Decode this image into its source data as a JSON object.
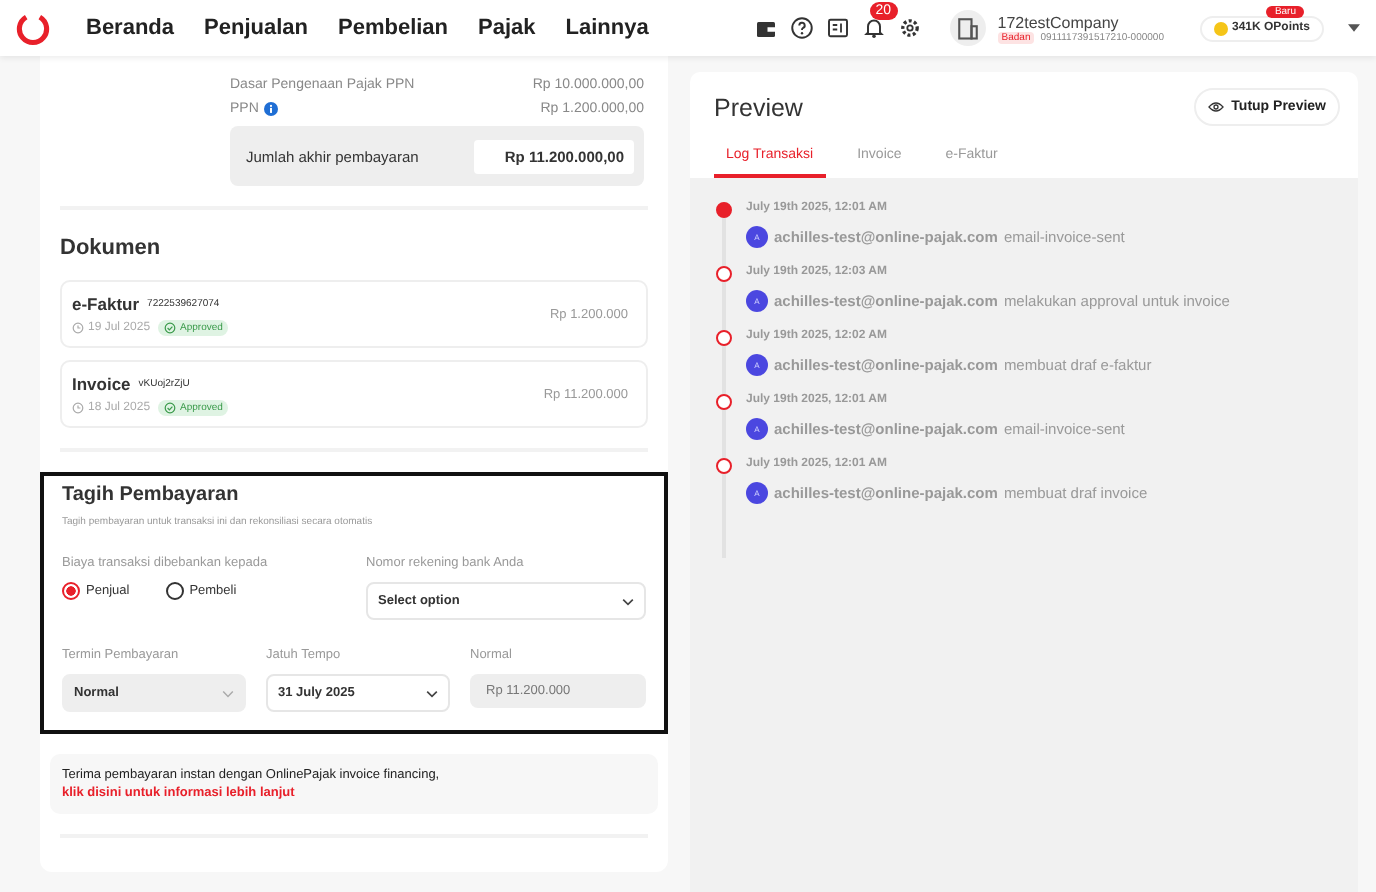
{
  "header": {
    "nav": [
      "Beranda",
      "Penjualan",
      "Pembelian",
      "Pajak",
      "Lainnya"
    ],
    "notification_count": "20",
    "company": "172testCompany",
    "company_badge": "Badan",
    "npwp": "0911117391517210-000000",
    "points": "341K OPoints",
    "points_badge": "Baru"
  },
  "summary": {
    "rows": [
      {
        "label": "Dasar Pengenaan Pajak PPN",
        "value": "Rp 10.000.000,00",
        "info": false
      },
      {
        "label": "PPN",
        "value": "Rp 1.200.000,00",
        "info": true
      }
    ],
    "total": {
      "label": "Jumlah akhir pembayaran",
      "value": "Rp 11.200.000,00"
    }
  },
  "documents": {
    "title": "Dokumen",
    "items": [
      {
        "type": "e-Faktur",
        "number": "7222539627074",
        "date": "19 Jul 2025",
        "status": "Approved",
        "amount": "Rp 1.200.000"
      },
      {
        "type": "Invoice",
        "number": "vKUoj2rZjU",
        "date": "18 Jul 2025",
        "status": "Approved",
        "amount": "Rp 11.200.000"
      }
    ]
  },
  "billing": {
    "title": "Tagih Pembayaran",
    "subtitle": "Tagih pembayaran untuk transaksi ini dan rekonsiliasi secara otomatis",
    "charge_label": "Biaya transaksi dibebankan kepada",
    "options": [
      {
        "label": "Penjual",
        "selected": true
      },
      {
        "label": "Pembeli",
        "selected": false
      }
    ],
    "bank_label": "Nomor rekening bank Anda",
    "bank_placeholder": "Select option",
    "term_label": "Termin Pembayaran",
    "term_value": "Normal",
    "due_label": "Jatuh Tempo",
    "due_value": "31 July 2025",
    "normal_label": "Normal",
    "normal_value": "Rp 11.200.000"
  },
  "financing": {
    "text": "Terima pembayaran instan dengan OnlinePajak invoice financing,",
    "link": "klik disini untuk informasi lebih lanjut"
  },
  "preview": {
    "title": "Preview",
    "close_button": "Tutup Preview",
    "tabs": [
      {
        "label": "Log Transaksi",
        "selected": true
      },
      {
        "label": "Invoice",
        "selected": false
      },
      {
        "label": "e-Faktur",
        "selected": false
      }
    ],
    "log": [
      {
        "time": "July 19th 2025, 12:01 AM",
        "avatar": "A",
        "user": "achilles-test@online-pajak.com",
        "action": "email-invoice-sent",
        "active": true
      },
      {
        "time": "July 19th 2025, 12:03 AM",
        "avatar": "A",
        "user": "achilles-test@online-pajak.com",
        "action": "melakukan approval untuk invoice",
        "active": false
      },
      {
        "time": "July 19th 2025, 12:02 AM",
        "avatar": "A",
        "user": "achilles-test@online-pajak.com",
        "action": "membuat draf e-faktur",
        "active": false
      },
      {
        "time": "July 19th 2025, 12:01 AM",
        "avatar": "A",
        "user": "achilles-test@online-pajak.com",
        "action": "email-invoice-sent",
        "active": false
      },
      {
        "time": "July 19th 2025, 12:01 AM",
        "avatar": "A",
        "user": "achilles-test@online-pajak.com",
        "action": "membuat draf invoice",
        "active": false
      }
    ]
  }
}
